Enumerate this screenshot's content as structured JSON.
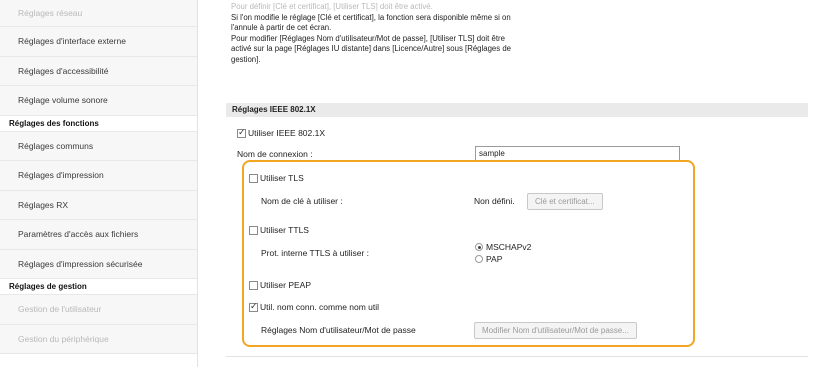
{
  "sidebar": {
    "items": [
      {
        "type": "item",
        "label": "Réglages réseau",
        "faded": true
      },
      {
        "type": "item",
        "label": "Réglages d'interface externe"
      },
      {
        "type": "item",
        "label": "Réglages d'accessibilité"
      },
      {
        "type": "item",
        "label": "Réglage volume sonore"
      },
      {
        "type": "header",
        "label": "Réglages des fonctions"
      },
      {
        "type": "item",
        "label": "Réglages communs"
      },
      {
        "type": "item",
        "label": "Réglages d'impression"
      },
      {
        "type": "item",
        "label": "Réglages RX"
      },
      {
        "type": "item",
        "label": "Paramètres d'accès aux fichiers"
      },
      {
        "type": "item",
        "label": "Réglages d'impression sécurisée"
      },
      {
        "type": "header",
        "label": "Réglages de gestion"
      },
      {
        "type": "item",
        "label": "Gestion de l'utilisateur",
        "faded": true
      },
      {
        "type": "item",
        "label": "Gestion du périphérique",
        "faded": true
      }
    ]
  },
  "intro": {
    "line1": "Pour définir [Clé et certificat], [Utiliser TLS] doit être activé.",
    "line2": "Si l'on modifie le réglage [Clé et certificat], la fonction sera disponible même si on",
    "line3": "l'annule à partir de cet écran.",
    "line4": "Pour modifier [Réglages Nom d'utilisateur/Mot de passe], [Utiliser TLS] doit être",
    "line5": "activé sur la page [Réglages IU distante] dans [Licence/Autre] sous [Réglages de",
    "line6": "gestion]."
  },
  "section": {
    "title": "Réglages IEEE 802.1X",
    "use_ieee_label": "Utiliser IEEE 802.1X",
    "use_ieee_checked": true,
    "login_name_label": "Nom de connexion :",
    "login_name_value": "sample",
    "use_tls_label": "Utiliser TLS",
    "use_tls_checked": false,
    "key_label": "Nom de clé à utiliser :",
    "key_value": "Non défini.",
    "key_button": "Clé et certificat...",
    "use_ttls_label": "Utiliser TTLS",
    "use_ttls_checked": false,
    "ttls_protocol_label": "Prot. interne TTLS à utiliser :",
    "ttls_options": [
      {
        "label": "MSCHAPv2",
        "checked": true
      },
      {
        "label": "PAP",
        "checked": false
      }
    ],
    "use_peap_label": "Utiliser PEAP",
    "use_peap_checked": false,
    "use_login_as_user_label": "Util. nom conn. comme nom util",
    "use_login_as_user_checked": true,
    "user_pw_label": "Réglages Nom d'utilisateur/Mot de passe",
    "user_pw_button": "Modifier Nom d'utilisateur/Mot de passe..."
  },
  "colors": {
    "highlight": "#f2a623",
    "section_header_bg": "#eaeaea",
    "faded_text": "#b9b9b9"
  }
}
